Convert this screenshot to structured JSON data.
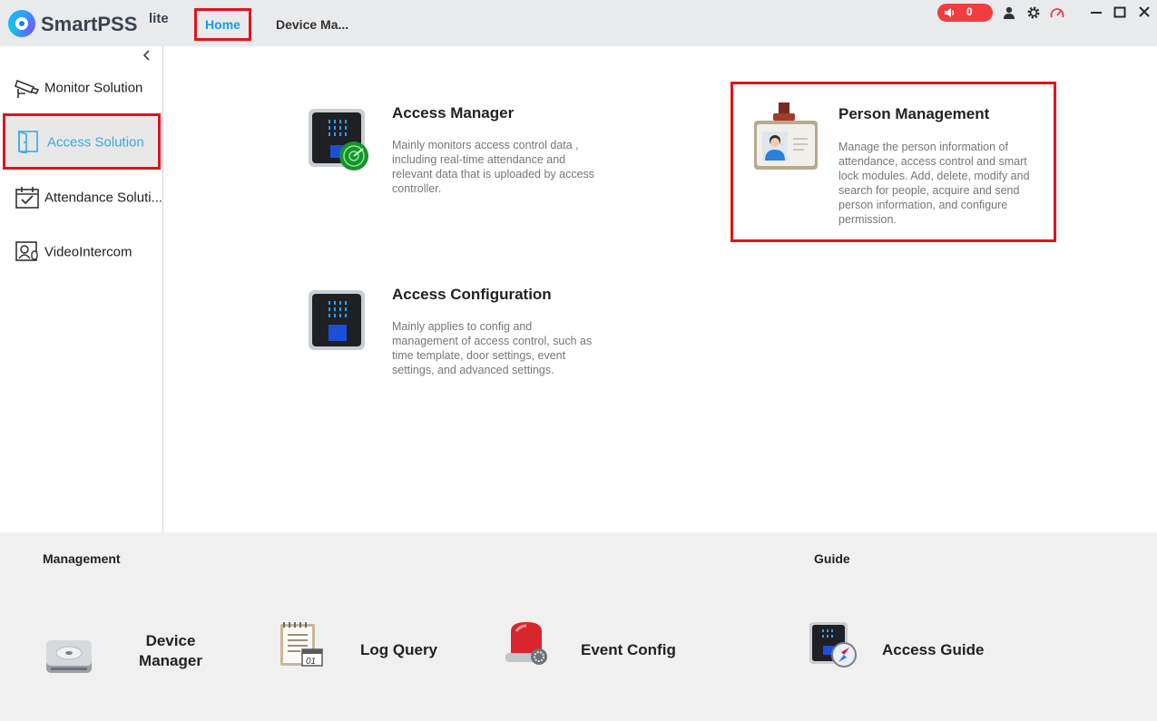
{
  "app": {
    "name": "SmartPSS",
    "suffix": "lite"
  },
  "tabs": {
    "home": "Home",
    "device": "Device Ma..."
  },
  "titlebar": {
    "alarm_count": "0"
  },
  "sidebar": {
    "items": [
      {
        "label": "Monitor Solution"
      },
      {
        "label": "Access Solution"
      },
      {
        "label": "Attendance Soluti..."
      },
      {
        "label": "VideoIntercom"
      }
    ]
  },
  "main": {
    "access_manager": {
      "title": "Access Manager",
      "desc": "Mainly monitors access control data , including real-time attendance and relevant data that is uploaded by access controller."
    },
    "access_configuration": {
      "title": "Access Configuration",
      "desc": "Mainly applies to config and management of access control, such as time template, door settings, event settings, and advanced settings."
    },
    "person_management": {
      "title": "Person Management",
      "desc": "Manage the person information of attendance, access control and smart lock modules. Add, delete, modify and search for people, acquire and send person information, and configure permission."
    }
  },
  "bottom": {
    "management_title": "Management",
    "guide_title": "Guide",
    "device_manager": "Device Manager",
    "log_query": "Log Query",
    "event_config": "Event Config",
    "access_guide": "Access Guide"
  },
  "colors": {
    "accent": "#1a9be8",
    "highlight": "#e0141e",
    "alarm": "#ef3d40"
  }
}
